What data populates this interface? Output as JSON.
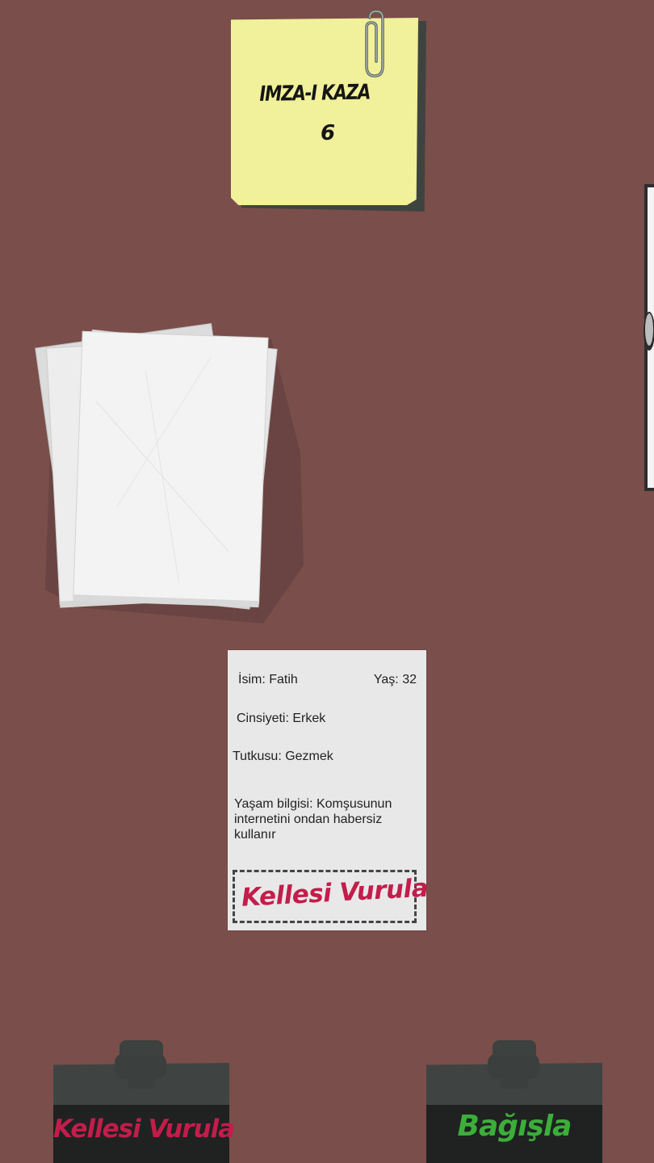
{
  "sticky_note": {
    "title": "IMZA-I KAZA",
    "count": "6"
  },
  "document": {
    "name": "İsim: Fatih",
    "age": "Yaş: 32",
    "gender": "Cinsiyeti: Erkek",
    "passion": "Tutkusu: Gezmek",
    "life_info": "Yaşam bilgisi: Komşusunun internetini ondan habersiz kullanır",
    "stamp": "Kellesi Vurula"
  },
  "buttons": {
    "execute_label": "Kellesi Vurula",
    "forgive_label": "Bağışla"
  },
  "colors": {
    "background": "#7a4e4a",
    "execute": "#c21d4b",
    "forgive": "#3cae3a",
    "sticky": "#f1f09b"
  }
}
